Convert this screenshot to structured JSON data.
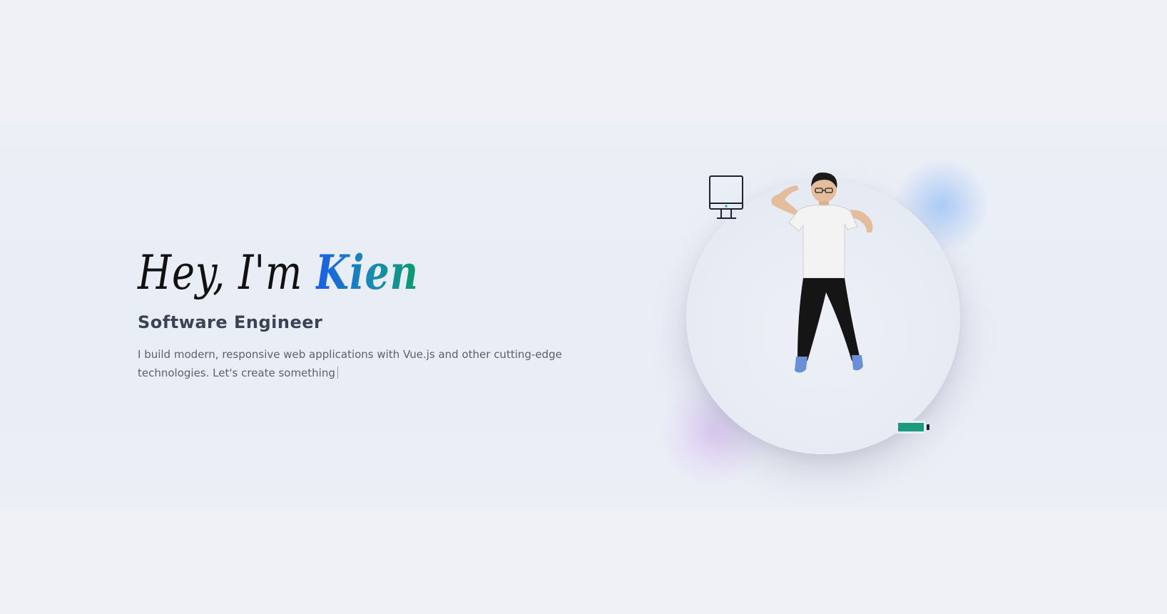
{
  "hero": {
    "greeting_prefix": "Hey, I'm ",
    "name": "Kien",
    "role": "Software Engineer",
    "bio": "I build modern, responsive web applications with Vue.js and other cutting-edge technologies. Let's create something"
  },
  "icons": {
    "device": "desktop-monitor-icon",
    "battery": "battery-icon",
    "avatar": "3d-avatar-figure"
  },
  "colors": {
    "name_gradient_start": "#1a5fe6",
    "name_gradient_end": "#0d9a6e",
    "role": "#3a4254",
    "bio": "#5a6070",
    "battery_fill": "#1a9a7e",
    "monitor_stroke": "#1c2233",
    "monitor_dot": "#19b8a6"
  }
}
